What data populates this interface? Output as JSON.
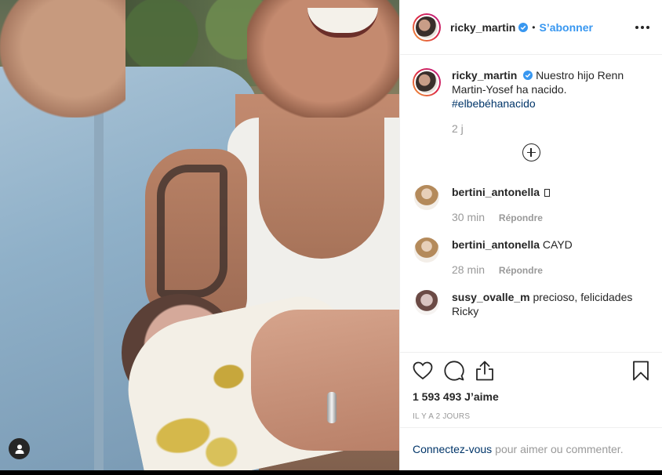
{
  "post": {
    "author": "ricky_martin",
    "follow_label": "S’abonner",
    "dot": "•",
    "caption_text": "Nuestro hijo Renn Martin-Yosef ha nacido.",
    "hashtag": "#elbebéhanacido",
    "caption_age": "2 j"
  },
  "comments": [
    {
      "user": "bertini_antonella",
      "text": "",
      "age": "30 min",
      "reply": "Répondre"
    },
    {
      "user": "bertini_antonella",
      "text": "CAYD",
      "age": "28 min",
      "reply": "Répondre"
    },
    {
      "user": "susy_ovalle_m",
      "text": "precioso, felicidades Ricky"
    }
  ],
  "likes": "1 593 493 J’aime",
  "date": "IL Y A 2 JOURS",
  "login": {
    "link": "Connectez-vous",
    "rest": "pour aimer ou commenter."
  },
  "colors": {
    "link_blue": "#3897f0",
    "hashtag": "#003569",
    "muted": "#999999",
    "verified": "#3897f0"
  },
  "icons": [
    "user-tag-icon",
    "verified-icon",
    "more-options-icon",
    "load-more-icon",
    "heart-icon",
    "comment-icon",
    "share-icon",
    "bookmark-icon"
  ]
}
